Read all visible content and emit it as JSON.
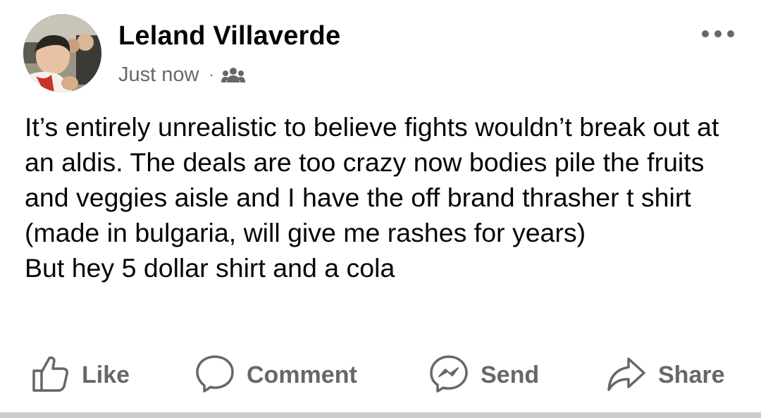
{
  "post": {
    "author_name": "Leland Villaverde",
    "timestamp": "Just now",
    "separator": "·",
    "audience_icon": "friends-icon",
    "more_icon": "more-options-icon",
    "text": "It’s entirely unrealistic to believe fights wouldn’t break out at an aldis. The deals are too crazy now bodies pile the fruits and veggies aisle and I have the off brand thrasher t shirt (made in bulgaria, will give me rashes for years)\nBut hey 5 dollar shirt and a cola"
  },
  "actions": [
    {
      "label": "Like",
      "icon": "thumbs-up-icon"
    },
    {
      "label": "Comment",
      "icon": "comment-bubble-icon"
    },
    {
      "label": "Send",
      "icon": "messenger-icon"
    },
    {
      "label": "Share",
      "icon": "share-arrow-icon"
    }
  ],
  "colors": {
    "text_primary": "#050505",
    "text_secondary": "#65676b",
    "divider": "#c9ccd1",
    "background": "#ffffff"
  }
}
